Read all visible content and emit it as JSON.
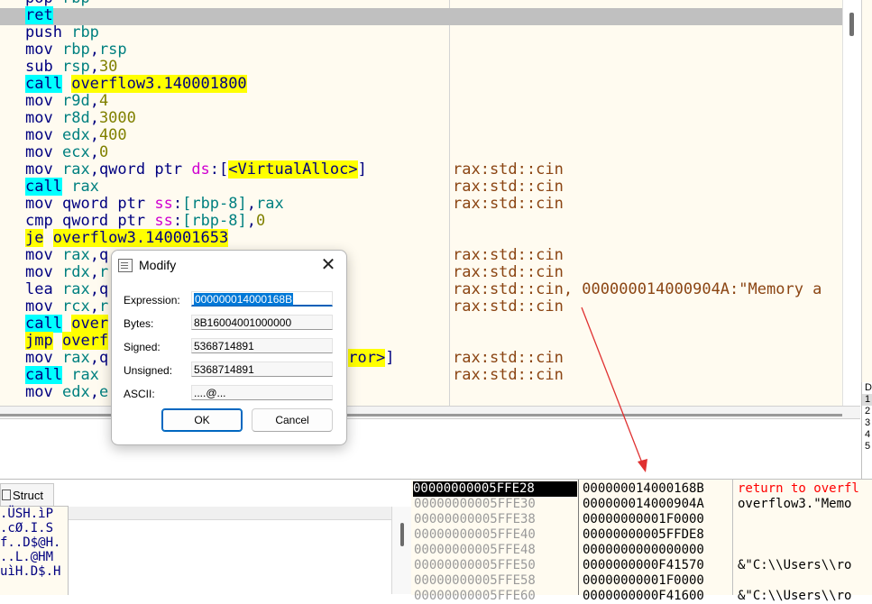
{
  "disasm": {
    "rows": [
      {
        "instr_html": "<span class=\"mn\">pop</span> <span class=\"reg\">rbp</span>",
        "comment": ""
      },
      {
        "instr_html": "<span class=\"hl-cyan mn\">ret</span>",
        "comment": ""
      },
      {
        "instr_html": "<span class=\"mn\">push</span> <span class=\"reg\">rbp</span>",
        "comment": ""
      },
      {
        "instr_html": "<span class=\"mn\">mov</span> <span class=\"reg\">rbp</span>,<span class=\"reg\">rsp</span>",
        "comment": ""
      },
      {
        "instr_html": "<span class=\"mn\">sub</span> <span class=\"reg\">rsp</span>,<span class=\"num\">30</span>",
        "comment": ""
      },
      {
        "instr_html": "<span class=\"hl-cyan mn\">call</span> <span class=\"hl-yel\">overflow3.140001800</span>",
        "comment": ""
      },
      {
        "instr_html": "<span class=\"mn\">mov</span> <span class=\"reg\">r9d</span>,<span class=\"num\">4</span>",
        "comment": ""
      },
      {
        "instr_html": "<span class=\"mn\">mov</span> <span class=\"reg\">r8d</span>,<span class=\"num\">3000</span>",
        "comment": ""
      },
      {
        "instr_html": "<span class=\"mn\">mov</span> <span class=\"reg\">edx</span>,<span class=\"num\">400</span>",
        "comment": ""
      },
      {
        "instr_html": "<span class=\"mn\">mov</span> <span class=\"reg\">ecx</span>,<span class=\"num\">0</span>",
        "comment": ""
      },
      {
        "instr_html": "<span class=\"mn\">mov</span> <span class=\"reg\">rax</span>,<span class=\"mn\">qword ptr</span> <span class=\"seg\">ds</span>:[<span class=\"hl-yel\">&lt;VirtualAlloc&gt;</span>]",
        "comment": "rax:std::cin"
      },
      {
        "instr_html": "<span class=\"hl-cyan mn\">call</span> <span class=\"reg\">rax</span>",
        "comment": "rax:std::cin"
      },
      {
        "instr_html": "<span class=\"mn\">mov</span> <span class=\"mn\">qword ptr</span> <span class=\"seg\">ss</span>:<span class=\"brk\">[</span><span class=\"reg\">rbp-8</span><span class=\"brk\">]</span>,<span class=\"reg\">rax</span>",
        "comment": "rax:std::cin"
      },
      {
        "instr_html": "<span class=\"mn\">cmp</span> <span class=\"mn\">qword ptr</span> <span class=\"seg\">ss</span>:<span class=\"brk\">[</span><span class=\"reg\">rbp-8</span><span class=\"brk\">]</span>,<span class=\"num\">0</span>",
        "comment": ""
      },
      {
        "instr_html": "<span class=\"hl-yel mn\">je</span> <span class=\"hl-yel\">overflow3.140001653</span>",
        "comment": ""
      },
      {
        "instr_html": "<span class=\"mn\">mov</span> <span class=\"reg\">rax</span>,<span class=\"mn\">q</span>",
        "comment": "rax:std::cin"
      },
      {
        "instr_html": "<span class=\"mn\">mov</span> <span class=\"reg\">rdx</span>,<span class=\"reg\">r</span>",
        "comment": "rax:std::cin"
      },
      {
        "instr_html": "<span class=\"mn\">lea</span> <span class=\"reg\">rax</span>,<span class=\"mn\">q</span>",
        "comment": "rax:std::cin, 000000014000904A:\"Memory a"
      },
      {
        "instr_html": "<span class=\"mn\">mov</span> <span class=\"reg\">rcx</span>,<span class=\"reg\">r</span>",
        "comment": "rax:std::cin"
      },
      {
        "instr_html": "<span class=\"hl-cyan mn\">call</span> <span class=\"hl-yel\">over</span>",
        "comment": ""
      },
      {
        "instr_html": "<span class=\"hl-yel mn\">jmp</span> <span class=\"hl-yel\">overf</span>",
        "comment": ""
      },
      {
        "instr_html": "<span class=\"mn\">mov</span> <span class=\"reg\">rax</span>,<span class=\"mn\">q</span>                          <span class=\"hl-yel\">ror&gt;</span>]",
        "comment": "rax:std::cin"
      },
      {
        "instr_html": "<span class=\"hl-cyan mn\">call</span> <span class=\"reg\">rax</span>",
        "comment": "rax:std::cin"
      },
      {
        "instr_html": "<span class=\"mn\">mov</span> <span class=\"reg\">edx</span>,<span class=\"reg\">e</span>",
        "comment": ""
      }
    ]
  },
  "right_panel": {
    "labels": [
      "D",
      "1",
      "2",
      "3",
      "4",
      "5"
    ]
  },
  "struct_tab": {
    "label": "Struct"
  },
  "dump_left": {
    "lines": [
      ".ÜSH.ìP",
      ".cØ.I.S",
      "f..D$@H.",
      "..L.@HM",
      "uìH.D$.H"
    ]
  },
  "stack": {
    "rows": [
      {
        "addr": "00000000005FFE28",
        "value": "000000014000168B",
        "comment": "return to overfl",
        "current": true,
        "red": true
      },
      {
        "addr": "00000000005FFE30",
        "value": "000000014000904A",
        "comment": "overflow3.\"Memo",
        "current": false,
        "red": false
      },
      {
        "addr": "00000000005FFE38",
        "value": "00000000001F0000",
        "comment": "",
        "current": false,
        "red": false
      },
      {
        "addr": "00000000005FFE40",
        "value": "00000000005FFDE8",
        "comment": "",
        "current": false,
        "red": false
      },
      {
        "addr": "00000000005FFE48",
        "value": "0000000000000000",
        "comment": "",
        "current": false,
        "red": false
      },
      {
        "addr": "00000000005FFE50",
        "value": "0000000000F41570",
        "comment": "&\"C:\\\\Users\\\\ro",
        "current": false,
        "red": false
      },
      {
        "addr": "00000000005FFE58",
        "value": "00000000001F0000",
        "comment": "",
        "current": false,
        "red": false
      },
      {
        "addr": "00000000005FFE60",
        "value": "0000000000F41600",
        "comment": "&\"C:\\\\Users\\\\ro",
        "current": false,
        "red": false
      }
    ]
  },
  "dialog": {
    "title": "Modify",
    "close_glyph": "✕",
    "expression_label": "Expression:",
    "expression_value": "000000014000168B",
    "bytes_label": "Bytes:",
    "bytes_value": "8B16004001000000",
    "signed_label": "Signed:",
    "signed_value": "5368714891",
    "unsigned_label": "Unsigned:",
    "unsigned_value": "5368714891",
    "ascii_label": "ASCII:",
    "ascii_value": "....@...",
    "ok_label": "OK",
    "cancel_label": "Cancel"
  },
  "colors": {
    "annotation_arrow": "#e03030",
    "highlight_cyan": "#00ffff",
    "highlight_yellow": "#ffff00",
    "selection_blue": "#0078d7"
  }
}
